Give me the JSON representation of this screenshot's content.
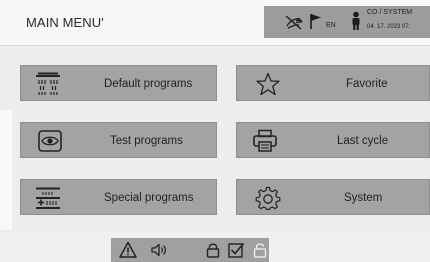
{
  "header": {
    "title": "MAIN MENU'",
    "status": {
      "language": "EN",
      "user": "CO / SYSTEM",
      "datetime": "04. 17. 2023  07:",
      "icons": [
        "no-touch-icon",
        "flag-icon",
        "user-icon"
      ]
    }
  },
  "menu": {
    "tiles": [
      {
        "id": "default-programs",
        "label": "Default programs",
        "icon": "shower-icon"
      },
      {
        "id": "favorite",
        "label": "Favorite",
        "icon": "star-icon"
      },
      {
        "id": "test-programs",
        "label": "Test programs",
        "icon": "eye-icon"
      },
      {
        "id": "last-cycle",
        "label": "Last cycle",
        "icon": "printer-icon"
      },
      {
        "id": "special-programs",
        "label": "Special programs",
        "icon": "special-program-icon"
      },
      {
        "id": "system",
        "label": "System",
        "icon": "gear-icon"
      }
    ]
  },
  "footer": {
    "icons": [
      "warning-icon",
      "speaker-icon",
      "lock-icon",
      "checkbox-icon",
      "unlock-icon"
    ]
  },
  "colors": {
    "tile": "#a3a3a3",
    "status_panel": "#9c9c9c",
    "background": "#ececec"
  }
}
